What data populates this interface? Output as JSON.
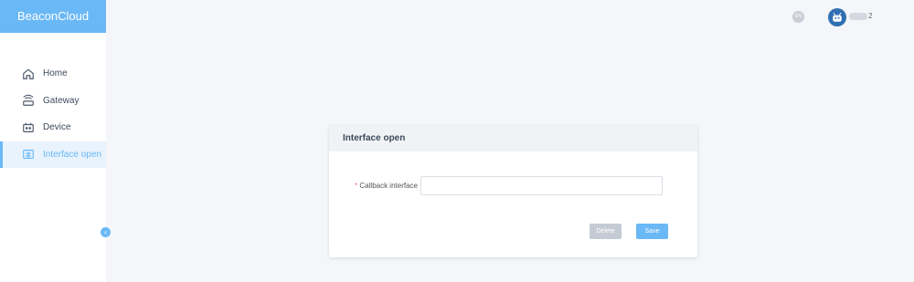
{
  "brand": {
    "title": "BeaconCloud"
  },
  "nav": {
    "items": [
      {
        "label": "Home",
        "icon": "home-icon"
      },
      {
        "label": "Gateway",
        "icon": "gateway-icon"
      },
      {
        "label": "Device",
        "icon": "device-icon"
      },
      {
        "label": "Interface open",
        "icon": "interface-icon",
        "active": true
      }
    ],
    "collapse": "‹"
  },
  "header": {
    "lang": "EN",
    "user_suffix": "2"
  },
  "card": {
    "title": "Interface open",
    "form": {
      "label": "Callback interface",
      "required_mark": "*",
      "value": "",
      "placeholder": ""
    },
    "buttons": {
      "delete": "Delete",
      "save": "Save"
    }
  },
  "colors": {
    "accent": "#6ab8f5",
    "active_bg": "#e8f3fd",
    "muted_button": "#c4cbd4"
  }
}
